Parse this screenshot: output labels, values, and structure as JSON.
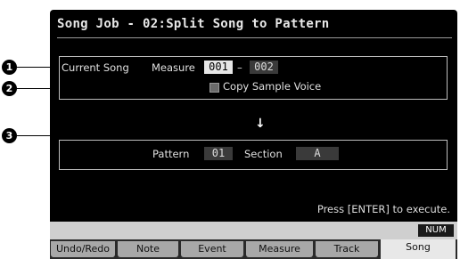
{
  "title": "Song Job - 02:Split Song to Pattern",
  "callouts": [
    "1",
    "2",
    "3"
  ],
  "source": {
    "label": "Current Song",
    "measure_label": "Measure",
    "measure_from": "001",
    "separator": "–",
    "measure_to": "002",
    "copy_sample_voice_label": "Copy Sample Voice",
    "copy_sample_voice_checked": false
  },
  "arrow": "↓",
  "destination": {
    "pattern_label": "Pattern",
    "pattern_value": "01",
    "section_label": "Section",
    "section_value": "A"
  },
  "footer_hint": "Press [ENTER] to execute.",
  "status": {
    "num_indicator": "NUM"
  },
  "tabs": [
    {
      "label": "Undo/Redo",
      "active": false
    },
    {
      "label": "Note",
      "active": false
    },
    {
      "label": "Event",
      "active": false
    },
    {
      "label": "Measure",
      "active": false
    },
    {
      "label": "Track",
      "active": false
    },
    {
      "label": "Song",
      "active": true
    }
  ]
}
